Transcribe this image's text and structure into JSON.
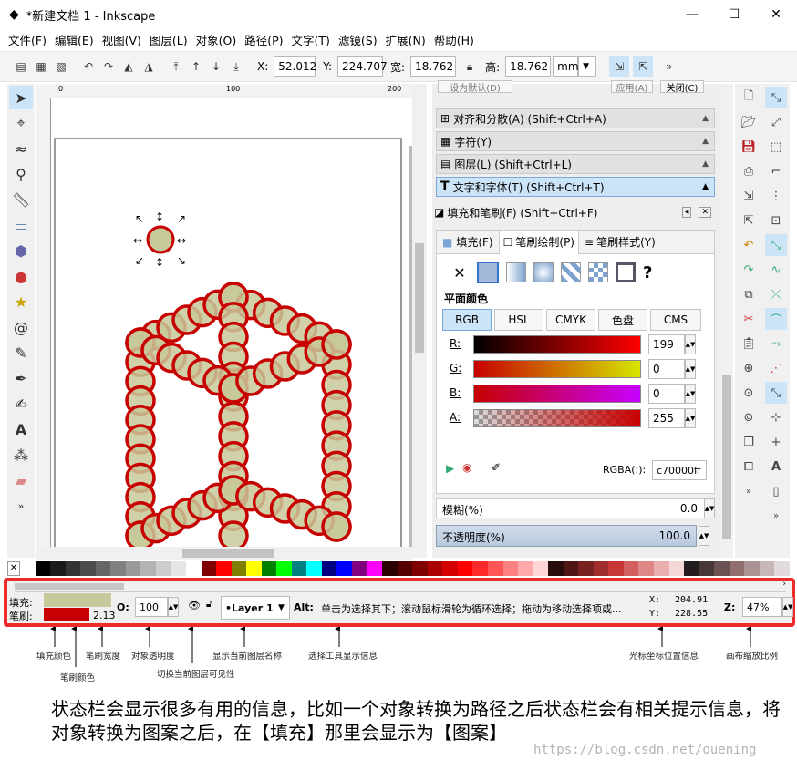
{
  "window": {
    "title": "*新建文档 1 - Inkscape",
    "min_label": "—",
    "max_label": "☐",
    "close_label": "✕"
  },
  "menu": [
    "文件(F)",
    "编辑(E)",
    "视图(V)",
    "图层(L)",
    "对象(O)",
    "路径(P)",
    "文字(T)",
    "滤镜(S)",
    "扩展(N)",
    "帮助(H)"
  ],
  "toolbar": {
    "x_label": "X:",
    "x_value": "52.012",
    "y_label": "Y:",
    "y_value": "224.707",
    "w_label": "宽:",
    "w_value": "18.762",
    "h_label": "高:",
    "h_value": "18.762",
    "unit": "mm",
    "more": "»"
  },
  "rulers": {
    "h_ticks": [
      "0",
      "100",
      "200"
    ]
  },
  "dock": {
    "top_buttons": [
      "设为默认(D)",
      "应用(A)",
      "关闭(C)"
    ],
    "panels": [
      {
        "label": "对齐和分散(A) (Shift+Ctrl+A)",
        "icon": "align-icon"
      },
      {
        "label": "字符(Y)",
        "icon": "glyph-icon"
      },
      {
        "label": "图层(L) (Shift+Ctrl+L)",
        "icon": "layers-icon"
      },
      {
        "label": "文字和字体(T) (Shift+Ctrl+T)",
        "icon": "text-icon"
      }
    ],
    "fill_title": "填充和笔刷(F) (Shift+Ctrl+F)",
    "tabs": [
      "填充(F)",
      "笔刷绘制(P)",
      "笔刷样式(Y)"
    ],
    "flat_color_label": "平面颜色",
    "color_modes": [
      "RGB",
      "HSL",
      "CMYK",
      "色盘",
      "CMS"
    ],
    "channels": [
      {
        "label": "R:",
        "value": "199"
      },
      {
        "label": "G:",
        "value": "0"
      },
      {
        "label": "B:",
        "value": "0"
      },
      {
        "label": "A:",
        "value": "255"
      }
    ],
    "rgba_label": "RGBA(:):",
    "rgba_value": "c70000ff",
    "blur_label": "模糊(%)",
    "blur_value": "0.0",
    "opacity_label": "不透明度(%)",
    "opacity_value": "100.0"
  },
  "statusbar": {
    "fill_label": "填充:",
    "stroke_label": "笔刷:",
    "stroke_width": "2.13",
    "opacity_label": "O:",
    "opacity_value": "100",
    "layer": "•Layer 1",
    "message_bold": "Alt:",
    "message": "单击为选择其下；滚动鼠标滑轮为循环选择；拖动为移动选择项或...",
    "x_label": "X:",
    "x_value": "204.91",
    "y_label": "Y:",
    "y_value": "228.55",
    "zoom_label": "Z:",
    "zoom_value": "47%"
  },
  "annotations": {
    "fill_color": "填充颜色",
    "stroke_color": "笔刷颜色",
    "stroke_width": "笔刷宽度",
    "opacity": "对象透明度",
    "visibility": "切换当前图层可见性",
    "layer_name": "显示当前图层名称",
    "tool_info": "选择工具显示信息",
    "cursor_pos": "光标坐标位置信息",
    "zoom": "画布缩放比例"
  },
  "caption": "状态栏会显示很多有用的信息，比如一个对象转换为路径之后状态栏会有相关提示信息，将对象转换为图案之后，在【填充】那里会显示为【图案】",
  "watermark": "https://blog.csdn.net/ouening",
  "colors": {
    "fill": "#c8c99a",
    "stroke": "#c70000",
    "highlight": "#ee2b2b"
  }
}
